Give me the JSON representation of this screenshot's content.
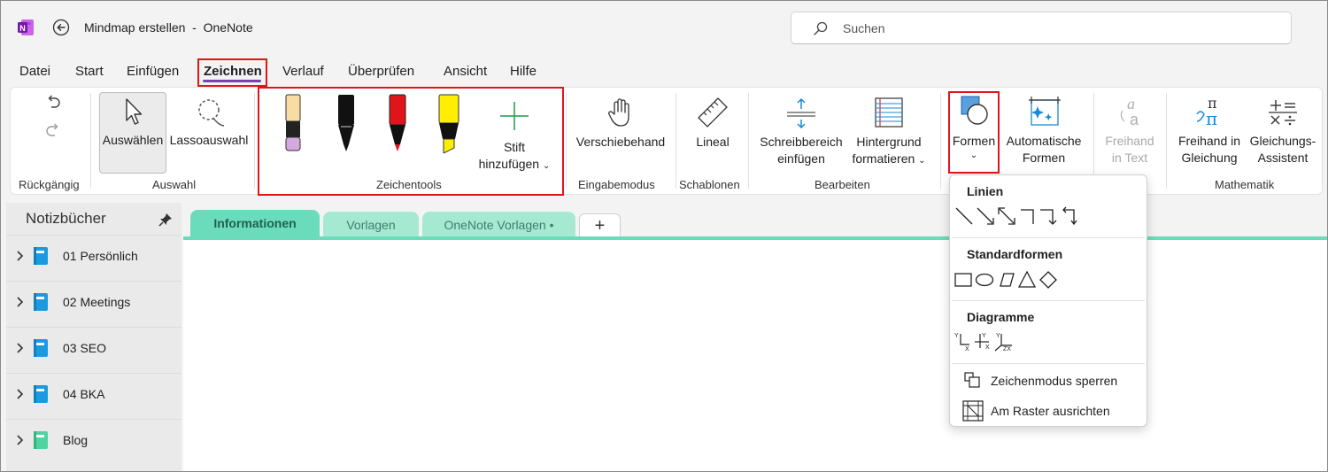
{
  "titlebar": {
    "title": "Mindmap erstellen  -  OneNote",
    "search_placeholder": "Suchen"
  },
  "menu": {
    "items": [
      "Datei",
      "Start",
      "Einfügen",
      "Zeichnen",
      "Verlauf",
      "Überprüfen",
      "Ansicht",
      "Hilfe"
    ],
    "active": "Zeichnen"
  },
  "ribbon": {
    "undo_group": "Rückgängig",
    "select_group": "Auswahl",
    "select_btn": "Auswählen",
    "lasso_btn": "Lassoauswahl",
    "tools_group": "Zeichentools",
    "add_pen_1": "Stift",
    "add_pen_2": "hinzufügen",
    "input_group": "Eingabemodus",
    "pan_btn": "Verschiebehand",
    "templates_group": "Schablonen",
    "ruler_btn": "Lineal",
    "edit_group": "Bearbeiten",
    "space_btn_1": "Schreibbereich",
    "space_btn_2": "einfügen",
    "bg_btn_1": "Hintergrund",
    "bg_btn_2": "formatieren",
    "shapes_btn": "Formen",
    "autoshapes_1": "Automatische",
    "autoshapes_2": "Formen",
    "ink_text_1": "Freihand",
    "ink_text_2": "in Text",
    "math_group": "Mathematik",
    "ink_math_1": "Freihand in",
    "ink_math_2": "Gleichung",
    "eq_1": "Gleichungs-",
    "eq_2": "Assistent"
  },
  "sidebar": {
    "header": "Notizbücher",
    "notebooks": [
      {
        "label": "01 Persönlich",
        "color": "#1a9be0"
      },
      {
        "label": "02 Meetings",
        "color": "#1a9be0"
      },
      {
        "label": "03 SEO",
        "color": "#1a9be0"
      },
      {
        "label": "04 BKA",
        "color": "#1a9be0"
      },
      {
        "label": "Blog",
        "color": "#4fd3a0"
      }
    ]
  },
  "tabs": {
    "t1": "Informationen",
    "t2": "Vorlagen",
    "t3": "OneNote Vorlagen •",
    "add": "+"
  },
  "dropdown": {
    "lines_header": "Linien",
    "standard_header": "Standardformen",
    "diagrams_header": "Diagramme",
    "lock_mode": "Zeichenmodus sperren",
    "snap_grid": "Am Raster ausrichten"
  },
  "colors": {
    "accent": "#7b3fb0",
    "highlight_box": "#e2141a",
    "section_tab": "#6bdcbb"
  }
}
